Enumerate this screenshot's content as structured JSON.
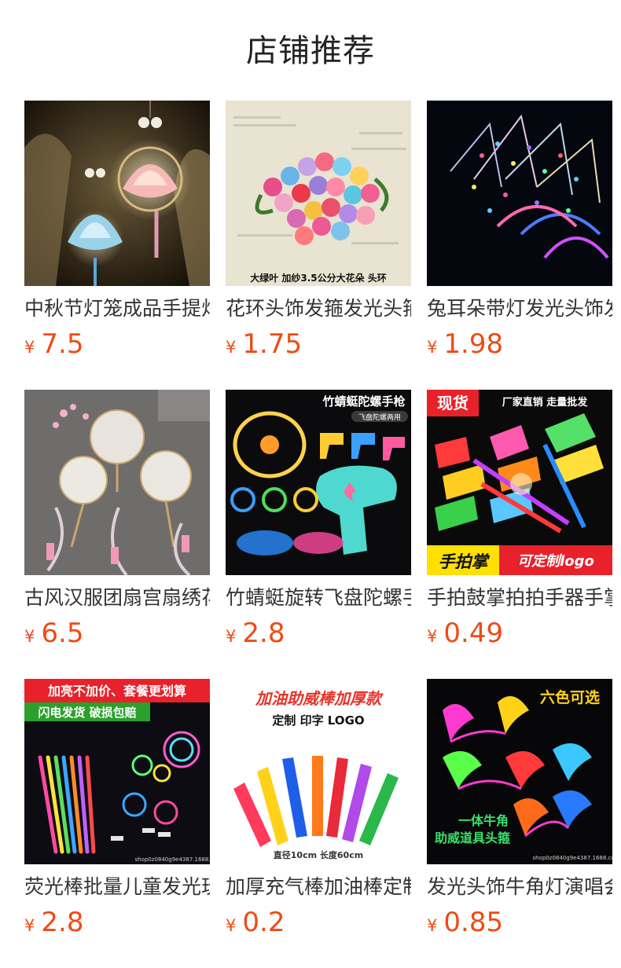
{
  "page": {
    "title": "店铺推荐"
  },
  "currency_symbol": "¥",
  "products": [
    {
      "name": "中秋节灯笼成品手提灯笼",
      "price": "7.5",
      "image": "mid-autumn-lantern-photo",
      "overlay": []
    },
    {
      "name": "花环头饰发箍发光头箍",
      "price": "1.75",
      "image": "flower-wreath-headband-photo",
      "overlay": [
        "大绿叶 加纱3.5公分大花朵 头环"
      ]
    },
    {
      "name": "兔耳朵带灯发光头饰发箍",
      "price": "1.98",
      "image": "glowing-bunny-ear-headband-photo",
      "overlay": []
    },
    {
      "name": "古风汉服团扇宫扇绣花扇",
      "price": "6.5",
      "image": "hanfu-round-fan-photo",
      "overlay": []
    },
    {
      "name": "竹蜻蜓旋转飞盘陀螺手枪",
      "price": "2.8",
      "image": "bamboo-dragonfly-launcher-photo",
      "overlay": [
        "竹蜻蜓陀螺手枪",
        "飞盘陀螺两用"
      ]
    },
    {
      "name": "手拍鼓掌拍拍手器手掌",
      "price": "0.49",
      "image": "hand-clapper-photo",
      "overlay": [
        "现货",
        "厂家直销 走量批发",
        "手拍掌",
        "可定制logo"
      ]
    },
    {
      "name": "荧光棒批量儿童发光玩具",
      "price": "2.8",
      "image": "glow-stick-bundle-photo",
      "overlay": [
        "加亮不加价、套餐更划算",
        "闪电发货  破损包赔",
        "shop0z0840g9e4387.1688.com"
      ]
    },
    {
      "name": "加厚充气棒加油棒定制",
      "price": "0.2",
      "image": "inflatable-cheer-stick-photo",
      "overlay": [
        "加油助威棒加厚款",
        "定制 印字 LOGO",
        "直径10cm  长度60cm"
      ]
    },
    {
      "name": "发光头饰牛角灯演唱会头箍",
      "price": "0.85",
      "image": "led-horn-headband-photo",
      "overlay": [
        "六色可选",
        "一体牛角",
        "助威道具头箍",
        "shop0z0840g9e4387.1688.com"
      ]
    }
  ],
  "colors": {
    "price": "#ee4b14",
    "text": "#333333",
    "title": "#222222"
  }
}
